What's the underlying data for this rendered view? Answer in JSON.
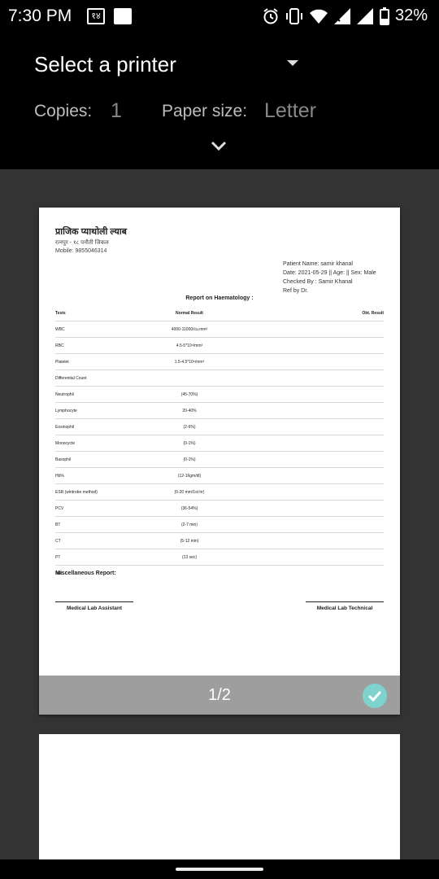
{
  "status_bar": {
    "time": "7:30 PM",
    "notif_number": "१४",
    "battery_percent": "32%",
    "icons": [
      "alarm-icon",
      "vibrate-icon",
      "wifi-icon",
      "signal-icon",
      "signal-x-icon",
      "battery-icon"
    ]
  },
  "header": {
    "printer_title": "Select a printer",
    "copies_label": "Copies:",
    "copies_value": "1",
    "paper_label": "Paper size:",
    "paper_value": "Letter"
  },
  "document": {
    "lab_name": "प्राजिक प्याथोली ल्याब",
    "lab_address": "रत्नपुर - १८ पनौती जिकल",
    "lab_mobile": "Mobile: 9855046314",
    "patient_name": "Patient Name: samir khanal",
    "date_line": "Date: 2021-05-29 || Age: || Sex: Male",
    "checked_by": "Checked By : Samir Khanal",
    "ref_by": "Ref by Dr.",
    "report_title": "Report on Haematology :",
    "table_headers": [
      "Tests",
      "Normal Result",
      "Obt. Result"
    ],
    "rows": [
      [
        "WBC",
        "4000-11000/cu.mm³",
        ""
      ],
      [
        "RBC",
        "4.5-5*10⁶/mm³",
        ""
      ],
      [
        "Platelet",
        "1.5-4.5*10⁵/mm³",
        ""
      ],
      [
        "Differential Count",
        "",
        ""
      ],
      [
        "Neutrophil",
        "(45-70%)",
        ""
      ],
      [
        "Lymphocyte",
        "20-40%",
        ""
      ],
      [
        "Eosinophil",
        "(2-6%)",
        ""
      ],
      [
        "Monocycte",
        "(0-1%)",
        ""
      ],
      [
        "Basophil",
        "(0-1%)",
        ""
      ],
      [
        "Hb%",
        "(12-16gm/dl)",
        ""
      ],
      [
        "ESR (wintrobe method)",
        "(0-20 mm/1st hr)",
        ""
      ],
      [
        "PCV",
        "(36-54%)",
        ""
      ],
      [
        "BT",
        "(2-7 min)",
        ""
      ],
      [
        "CT",
        "(5-12 min)",
        ""
      ],
      [
        "PT",
        "(13 sec)",
        ""
      ],
      [
        "INR",
        "",
        ""
      ]
    ],
    "misc_label": "Miscellaneous Report:",
    "sign_left": "Medical Lab Assistant",
    "sign_right": "Medical Lab Technical"
  },
  "preview": {
    "page_indicator": "1/2",
    "page_selected": true,
    "accent_color": "#7fd3cf"
  }
}
